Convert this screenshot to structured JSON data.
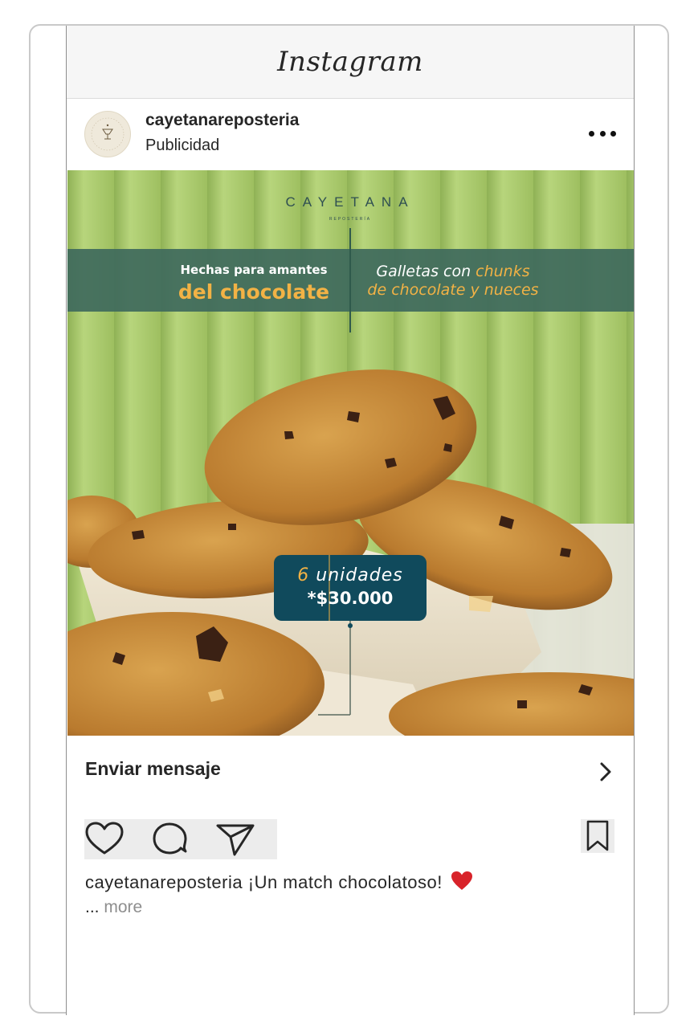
{
  "app": {
    "name": "Instagram"
  },
  "post": {
    "username": "cayetanareposteria",
    "label": "Publicidad",
    "more_icon": "more-horizontal-icon",
    "image": {
      "brand": "CAYETANA",
      "brand_sub": "REPOSTERÍA",
      "left_line1": "Hechas para amantes",
      "left_line2": "del chocolate",
      "right_line1_a": "Galletas con ",
      "right_line1_b": "chunks",
      "right_line2": "de chocolate y nueces",
      "price_line1_a": "6",
      "price_line1_b": "unidades",
      "price_line2": "*$30.000"
    },
    "cta": {
      "label": "Enviar mensaje",
      "icon": "chevron-right-icon"
    },
    "actions": [
      "heart-icon",
      "comment-icon",
      "share-icon",
      "bookmark-icon"
    ],
    "caption": {
      "username": "cayetanareposteria",
      "text": "¡Un match chocolatoso!",
      "emoji": "red-heart-emoji"
    },
    "ellipsis": "...",
    "more_label": "more"
  },
  "colors": {
    "banner": "#3f6b5c",
    "accent": "#f2b245",
    "price_box": "#104a5c",
    "background_green": "#a9c96d"
  }
}
